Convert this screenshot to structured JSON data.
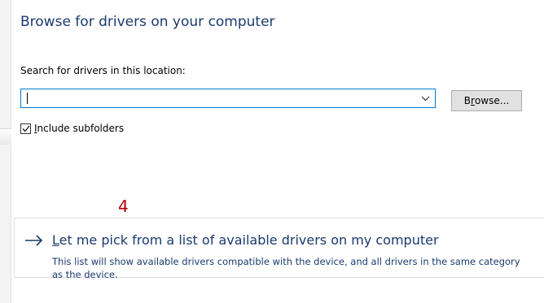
{
  "heading": "Browse for drivers on your computer",
  "search": {
    "label": "Search for drivers in this location:",
    "value": "",
    "browse_accel": "r",
    "browse_pre": "B",
    "browse_post": "owse..."
  },
  "subfolders": {
    "checked": true,
    "accel": "I",
    "label_rest": "nclude subfolders"
  },
  "annotation": "4",
  "pick": {
    "accel": "L",
    "title_rest": "et me pick from a list of available drivers on my computer",
    "description": "This list will show available drivers compatible with the device, and all drivers in the same category as the device."
  },
  "colors": {
    "link": "#1a3a6e",
    "focus_border": "#0078d7",
    "annotation": "#b00000"
  },
  "icons": {
    "combo": "chevron-down-icon",
    "checkbox": "checkmark-icon",
    "link": "arrow-right-icon"
  }
}
